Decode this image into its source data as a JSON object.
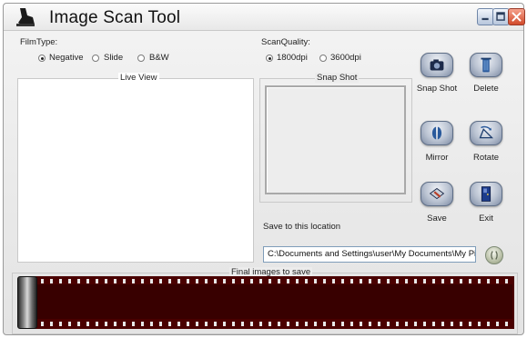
{
  "window": {
    "title": "Image Scan Tool",
    "controls": {
      "minimize": "minimize-icon",
      "maximize": "maximize-icon",
      "close": "close-icon"
    }
  },
  "film_type": {
    "label": "FilmType:",
    "options": [
      {
        "label": "Negative",
        "selected": true
      },
      {
        "label": "Slide",
        "selected": false
      },
      {
        "label": "B&W",
        "selected": false
      }
    ]
  },
  "scan_quality": {
    "label": "ScanQuality:",
    "options": [
      {
        "label": "1800dpi",
        "selected": true
      },
      {
        "label": "3600dpi",
        "selected": false
      }
    ]
  },
  "live_view": {
    "title": "Live View"
  },
  "snap_shot": {
    "title": "Snap Shot"
  },
  "actions": {
    "snap_shot": {
      "label": "Snap Shot",
      "icon": "camera-icon"
    },
    "delete": {
      "label": "Delete",
      "icon": "trash-icon"
    },
    "mirror": {
      "label": "Mirror",
      "icon": "mirror-icon"
    },
    "rotate": {
      "label": "Rotate",
      "icon": "rotate-icon"
    },
    "save": {
      "label": "Save",
      "icon": "save-icon"
    },
    "exit": {
      "label": "Exit",
      "icon": "exit-door-icon"
    }
  },
  "save_location": {
    "label": "Save to this location",
    "path": "C:\\Documents and Settings\\user\\My Documents\\My Pict",
    "browse_icon": "browse-icon"
  },
  "final_images": {
    "title": "Final images to save"
  },
  "colors": {
    "film": "#4a0000",
    "button_face": "#b9c2d1",
    "close_button": "#d24a2a"
  }
}
